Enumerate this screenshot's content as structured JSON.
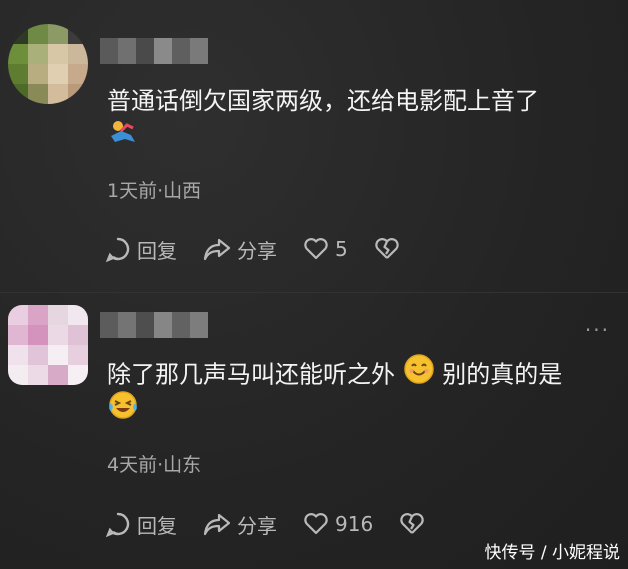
{
  "comments": [
    {
      "text": "普通话倒欠国家两级，还给电影配上音了",
      "emoji_inline": "",
      "emoji_line2": "running-person-emoji",
      "meta": "1天前·山西",
      "reply_label": "回复",
      "share_label": "分享",
      "like_count": "5"
    },
    {
      "text": "除了那几声马叫还能听之外",
      "text_after": "别的真的是",
      "emoji_inline": "smiling-face-emoji",
      "emoji_line2": "laughing-crying-emoji",
      "meta": "4天前·山东",
      "reply_label": "回复",
      "share_label": "分享",
      "like_count": "916",
      "more": "···"
    }
  ],
  "watermark": "快传号 / 小妮程说",
  "colors": {
    "background": "#262626",
    "text": "#f4f4f4",
    "meta": "#a8a8a8",
    "icon": "#b9b9b9"
  }
}
